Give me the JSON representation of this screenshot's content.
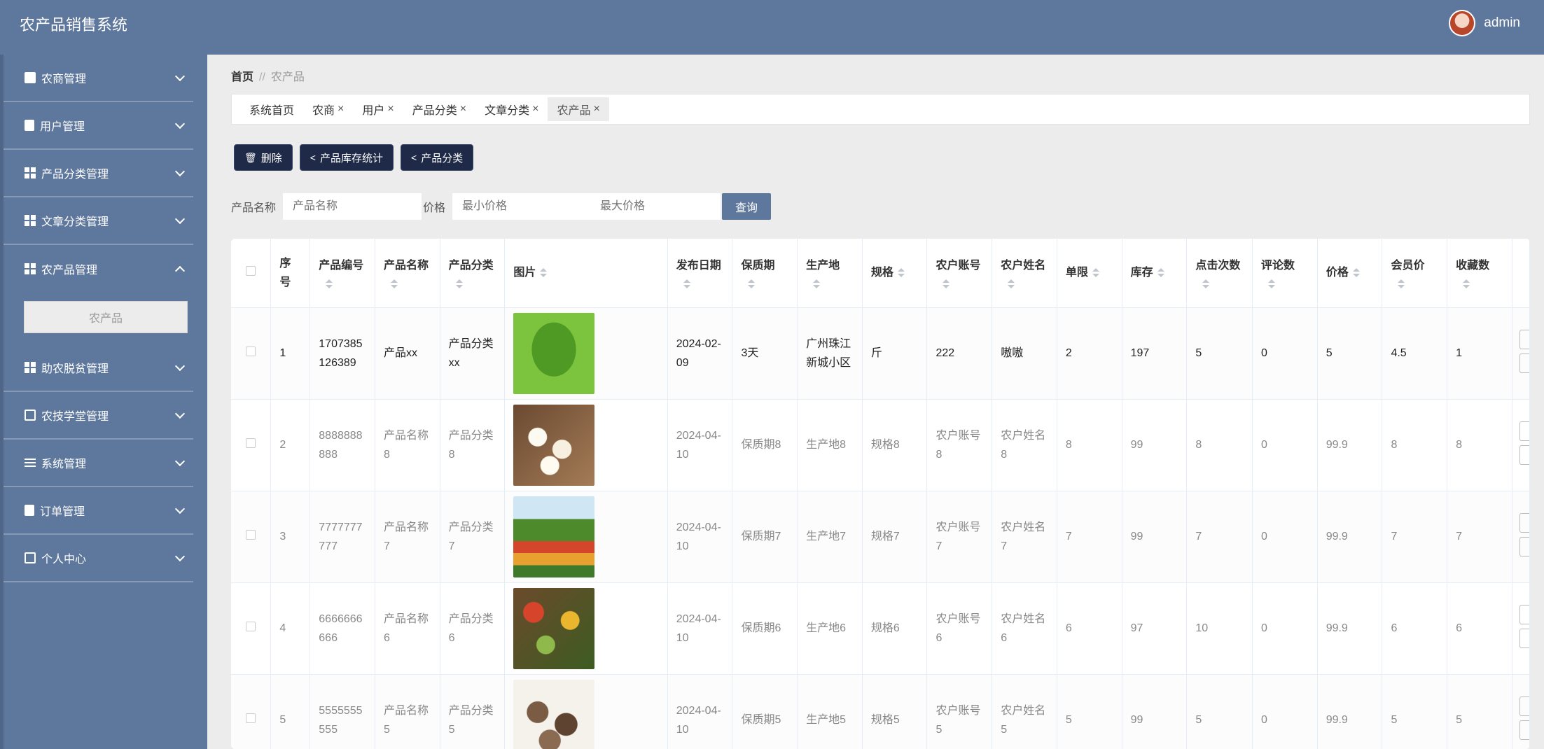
{
  "header": {
    "title": "农产品销售系统",
    "user_name": "admin"
  },
  "sidebar": {
    "items": [
      {
        "label": "农商管理",
        "icon": "briefcase-icon"
      },
      {
        "label": "用户管理",
        "icon": "clipboard-icon"
      },
      {
        "label": "产品分类管理",
        "icon": "grid-icon"
      },
      {
        "label": "文章分类管理",
        "icon": "grid-icon"
      },
      {
        "label": "农产品管理",
        "icon": "grid-icon",
        "expanded": true
      },
      {
        "label": "助农脱贫管理",
        "icon": "grid-icon"
      },
      {
        "label": "农技学堂管理",
        "icon": "chart-icon"
      },
      {
        "label": "系统管理",
        "icon": "sliders-icon"
      },
      {
        "label": "订单管理",
        "icon": "clipboard-icon"
      },
      {
        "label": "个人中心",
        "icon": "card-icon"
      }
    ],
    "submenu_item": "农产品"
  },
  "breadcrumb": {
    "home": "首页",
    "separator": "//",
    "current": "农产品"
  },
  "tabs": [
    {
      "label": "系统首页",
      "closable": false
    },
    {
      "label": "农商",
      "closable": true
    },
    {
      "label": "用户",
      "closable": true
    },
    {
      "label": "产品分类",
      "closable": true
    },
    {
      "label": "文章分类",
      "closable": true
    },
    {
      "label": "农产品",
      "closable": true,
      "active": true
    }
  ],
  "close_glyph": "×",
  "toolbar": {
    "delete": "删除",
    "stats": "产品库存统计",
    "category": "产品分类"
  },
  "search": {
    "name_label": "产品名称",
    "name_placeholder": "产品名称",
    "price_label": "价格",
    "min_placeholder": "最小价格",
    "max_placeholder": "最大价格",
    "query_button": "查询"
  },
  "table": {
    "columns": [
      "序号",
      "产品编号",
      "产品名称",
      "产品分类",
      "图片",
      "发布日期",
      "保质期",
      "生产地",
      "规格",
      "农户账号",
      "农户姓名",
      "单限",
      "库存",
      "点击次数",
      "评论数",
      "价格",
      "会员价",
      "收藏数"
    ],
    "rows": [
      {
        "index": "1",
        "code": "1707385126389",
        "name": "产品xx",
        "category": "产品分类xx",
        "image": "lettuce",
        "date": "2024-02-09",
        "shelf": "3天",
        "origin": "广州珠江新城小区",
        "spec": "斤",
        "account": "222",
        "farmer": "嗷嗷",
        "limit": "2",
        "stock": "197",
        "clicks": "5",
        "comments": "0",
        "price": "5",
        "vip_price": "4.5",
        "favorites": "1"
      },
      {
        "index": "2",
        "code": "8888888888",
        "name": "产品名称8",
        "category": "产品分类8",
        "image": "white-beans",
        "date": "2024-04-10",
        "shelf": "保质期8",
        "origin": "生产地8",
        "spec": "规格8",
        "account": "农户账号8",
        "farmer": "农户姓名8",
        "limit": "8",
        "stock": "99",
        "clicks": "8",
        "comments": "0",
        "price": "99.9",
        "vip_price": "8",
        "favorites": "8"
      },
      {
        "index": "3",
        "code": "7777777777",
        "name": "产品名称7",
        "category": "产品分类7",
        "image": "vegetable-field",
        "date": "2024-04-10",
        "shelf": "保质期7",
        "origin": "生产地7",
        "spec": "规格7",
        "account": "农户账号7",
        "farmer": "农户姓名7",
        "limit": "7",
        "stock": "99",
        "clicks": "7",
        "comments": "0",
        "price": "99.9",
        "vip_price": "7",
        "favorites": "7"
      },
      {
        "index": "4",
        "code": "6666666666",
        "name": "产品名称6",
        "category": "产品分类6",
        "image": "mixed-produce",
        "date": "2024-04-10",
        "shelf": "保质期6",
        "origin": "生产地6",
        "spec": "规格6",
        "account": "农户账号6",
        "farmer": "农户姓名6",
        "limit": "6",
        "stock": "97",
        "clicks": "10",
        "comments": "0",
        "price": "99.9",
        "vip_price": "6",
        "favorites": "6"
      },
      {
        "index": "5",
        "code": "5555555555",
        "name": "产品名称5",
        "category": "产品分类5",
        "image": "shiitake",
        "date": "2024-04-10",
        "shelf": "保质期5",
        "origin": "生产地5",
        "spec": "规格5",
        "account": "农户账号5",
        "farmer": "农户姓名5",
        "limit": "5",
        "stock": "99",
        "clicks": "5",
        "comments": "0",
        "price": "99.9",
        "vip_price": "5",
        "favorites": "5"
      }
    ]
  },
  "colors": {
    "sidebar": "#5e779c",
    "button": "#1e2a47",
    "background": "#ececec"
  }
}
